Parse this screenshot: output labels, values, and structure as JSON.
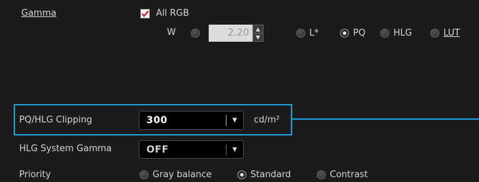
{
  "gamma": {
    "label": "Gamma",
    "all_rgb_label": "All RGB",
    "all_rgb_checked": true,
    "w_label": "W",
    "value": "2.20",
    "modes": [
      {
        "label": "L*",
        "selected": false,
        "underline": false
      },
      {
        "label": "PQ",
        "selected": true,
        "underline": false
      },
      {
        "label": "HLG",
        "selected": false,
        "underline": false
      },
      {
        "label": "LUT",
        "selected": false,
        "underline": true
      }
    ]
  },
  "clipping": {
    "label": "PQ/HLG Clipping",
    "value": "300",
    "unit": "cd/m²"
  },
  "hlg_system_gamma": {
    "label": "HLG System Gamma",
    "value": "OFF"
  },
  "priority": {
    "label": "Priority",
    "options": [
      {
        "label": "Gray balance",
        "selected": false
      },
      {
        "label": "Standard",
        "selected": true
      },
      {
        "label": "Contrast",
        "selected": false
      }
    ]
  },
  "colors": {
    "highlight": "#1e9fd8",
    "checkbox_check": "#d0212a"
  }
}
